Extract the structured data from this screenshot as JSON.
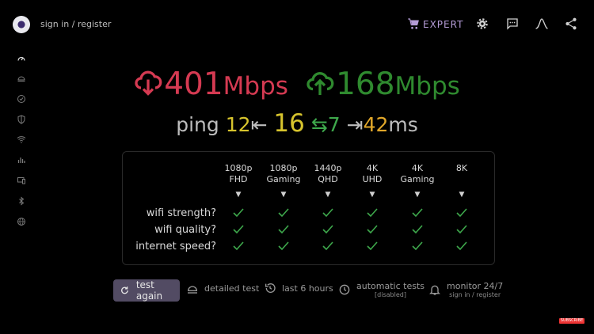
{
  "header": {
    "signin_label": "sign in / register",
    "expert_label": "EXPERT"
  },
  "sidebar": {
    "items": [
      "speed-icon",
      "video-icon",
      "check-circle-icon",
      "shield-icon",
      "wifi-icon",
      "bars-icon",
      "devices-icon",
      "bluetooth-icon",
      "globe-icon"
    ]
  },
  "result": {
    "download_value": "401",
    "download_unit": "Mbps",
    "upload_value": "168",
    "upload_unit": "Mbps",
    "ping_label": "ping",
    "ping_low": "12",
    "ping_mid": "16",
    "ping_jitter": "7",
    "ping_high": "42",
    "ping_unit": "ms"
  },
  "table": {
    "columns": [
      {
        "line1": "1080p",
        "line2": "FHD"
      },
      {
        "line1": "1080p",
        "line2": "Gaming"
      },
      {
        "line1": "1440p",
        "line2": "QHD"
      },
      {
        "line1": "4K",
        "line2": "UHD"
      },
      {
        "line1": "4K",
        "line2": "Gaming"
      },
      {
        "line1": "8K",
        "line2": ""
      }
    ],
    "arrow": "▼",
    "rows": [
      "wifi strength?",
      "wifi quality?",
      "internet speed?"
    ]
  },
  "footer": {
    "test_again": "test again",
    "detailed_test": "detailed test",
    "last_hours": "last 6 hours",
    "automatic_tests": "automatic tests",
    "automatic_sub": "[disabled]",
    "monitor": "monitor 24/7",
    "monitor_sub": "sign in / register"
  },
  "colors": {
    "download": "#d53a52",
    "upload": "#2f8a2f",
    "check": "#3ea84c",
    "accent": "#b49bd6"
  }
}
